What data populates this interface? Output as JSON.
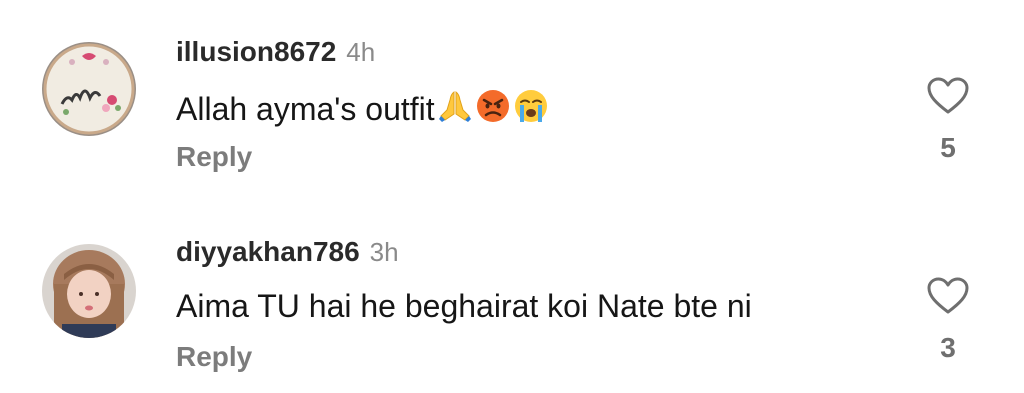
{
  "comments": [
    {
      "username": "illusion8672",
      "time": "4h",
      "text": "Allah ayma's outfit",
      "emojis": [
        "folded-hands-emoji",
        "angry-face-emoji",
        "crying-face-emoji"
      ],
      "reply_label": "Reply",
      "likes": "5"
    },
    {
      "username": "diyyakhan786",
      "time": "3h",
      "text": "Aima TU hai he beghairat koi Nate bte ni",
      "reply_label": "Reply",
      "likes": "3"
    }
  ],
  "colors": {
    "username": "#2a2a2a",
    "timestamp": "#8a8a8a",
    "comment_text": "#161616",
    "reply": "#7c7c7c",
    "like_count": "#6f6f6f",
    "heart_outline": "#6f6f6f"
  }
}
